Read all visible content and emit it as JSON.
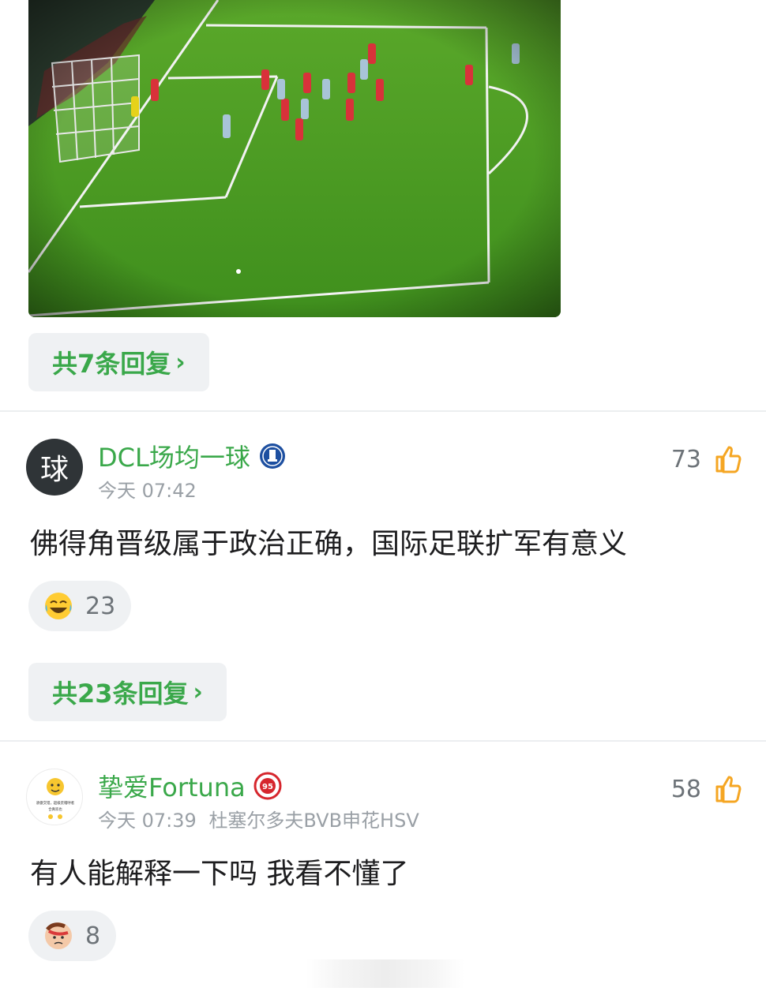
{
  "post": {
    "replies_label": "共7条回复",
    "chevron": "›"
  },
  "comments": [
    {
      "avatar_char": "球",
      "username": "DCL场均一球",
      "badge_icon": "everton-crest-icon",
      "time": "今天 07:42",
      "likes": "73",
      "text": "佛得角晋级属于政治正确，国际足联扩军有意义",
      "reaction_icon": "laugh-cry-emoji-icon",
      "reaction_count": "23",
      "replies_label": "共23条回复"
    },
    {
      "avatar_text": "骄傲交错，超级荒帽呼者",
      "avatar_text2": "合真欢也",
      "username": "挚爱Fortuna",
      "badge_icon": "fortuna-95-crest-icon",
      "time": "今天 07:39",
      "location": "杜塞尔多夫BVB申花HSV",
      "likes": "58",
      "text": "有人能解释一下吗 我看不懂了",
      "reaction_icon": "facepalm-emoji-icon",
      "reaction_count": "8"
    }
  ],
  "colors": {
    "accent_green": "#3aa84a",
    "like_orange": "#f5a623",
    "pill_bg": "#eff1f3"
  }
}
